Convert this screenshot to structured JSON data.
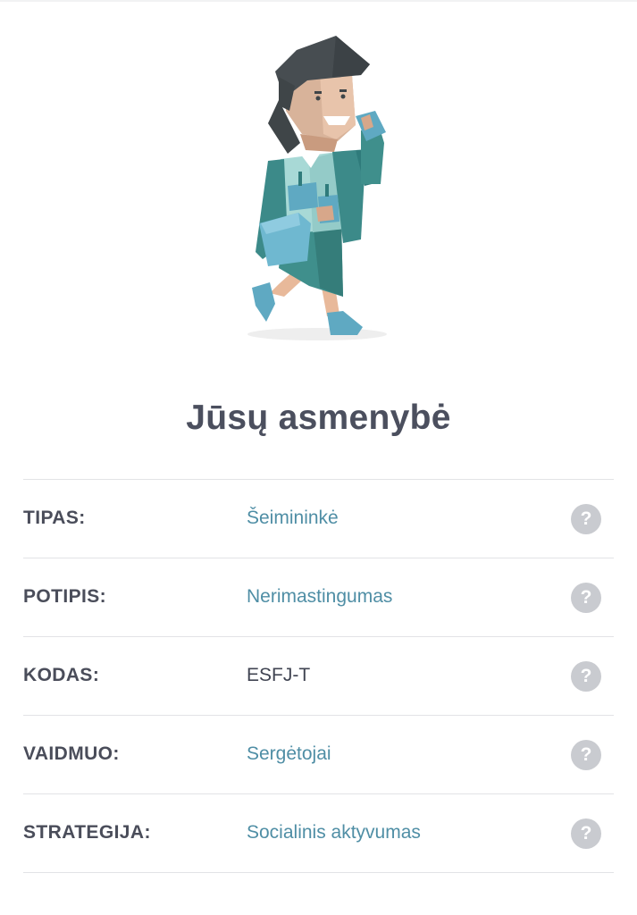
{
  "page": {
    "title": "Jūsų asmenybė"
  },
  "illustration": {
    "icon": "woman-phone-shopping-illustration"
  },
  "rows": [
    {
      "label": "TIPAS:",
      "value": "Šeimininkė",
      "value_style": "link",
      "help": "?"
    },
    {
      "label": "POTIPIS:",
      "value": "Nerimastingumas",
      "value_style": "link",
      "help": "?"
    },
    {
      "label": "KODAS:",
      "value": "ESFJ-T",
      "value_style": "plain",
      "help": "?"
    },
    {
      "label": "VAIDMUO:",
      "value": "Sergėtojai",
      "value_style": "link",
      "help": "?"
    },
    {
      "label": "STRATEGIJA:",
      "value": "Socialinis aktyvumas",
      "value_style": "link",
      "help": "?"
    }
  ],
  "colors": {
    "title": "#4b4f5e",
    "label": "#4a4d5a",
    "link_value": "#4f8ea5",
    "plain_value": "#404452",
    "help_button": "#c9cbd0",
    "divider": "#e2e3e6"
  }
}
